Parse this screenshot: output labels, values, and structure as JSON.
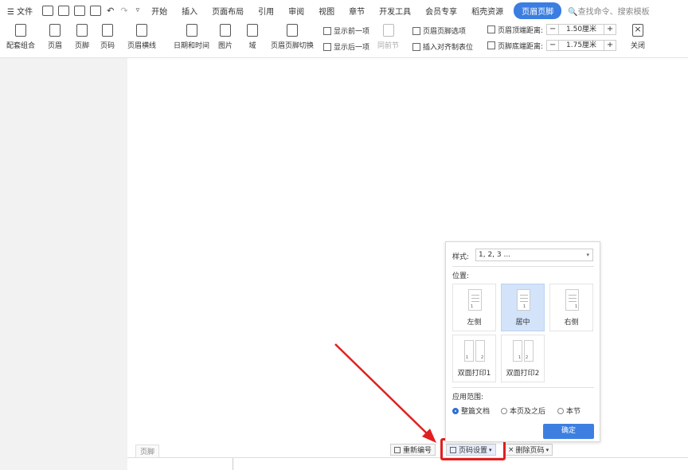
{
  "menubar": {
    "file": "文件",
    "tabs": [
      "开始",
      "插入",
      "页面布局",
      "引用",
      "审阅",
      "视图",
      "章节",
      "开发工具",
      "会员专享",
      "稻壳资源"
    ],
    "active_tab": "页眉页脚",
    "search": "查找命令、搜索模板"
  },
  "toolbar": {
    "combo": "配套组合",
    "header": "页眉",
    "footer": "页脚",
    "page_num": "页码",
    "header_line": "页眉横线",
    "datetime": "日期和时间",
    "picture": "图片",
    "field": "域",
    "switch": "页眉页脚切换",
    "show_prev": "显示前一项",
    "show_next": "显示后一项",
    "same_prev": "同前节",
    "hf_options": "页眉页脚选项",
    "insert_tab": "插入对齐制表位",
    "header_top_label": "页眉顶端距离:",
    "header_top_value": "1.50厘米",
    "footer_bottom_label": "页脚底端距离:",
    "footer_bottom_value": "1.75厘米",
    "close": "关闭"
  },
  "footer": {
    "tag": "页脚",
    "renumber": "重新编号",
    "page_settings": "页码设置",
    "delete_page": "删除页码"
  },
  "popup": {
    "style_label": "样式:",
    "style_value": "1, 2, 3 ...",
    "position_label": "位置:",
    "positions": [
      "左侧",
      "居中",
      "右侧",
      "双面打印1",
      "双面打印2"
    ],
    "scope_label": "应用范围:",
    "scope_options": [
      "整篇文档",
      "本页及之后",
      "本节"
    ],
    "ok": "确定"
  }
}
